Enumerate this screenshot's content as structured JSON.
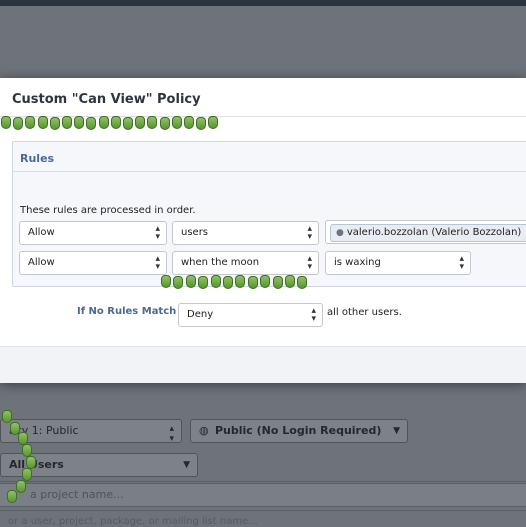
{
  "background": {
    "policy_select": "acy 1: Public",
    "visibility_select": "Public (No Login Required)",
    "users_select": "All Users",
    "project_search_placeholder": "a project name...",
    "bottom_hint": "or a user, project, package, or mailing list name..."
  },
  "dialog": {
    "title": "Custom \"Can View\" Policy",
    "rules": {
      "header": "Rules",
      "description": "These rules are processed in order.",
      "rows": [
        {
          "action": "Allow",
          "type": "users",
          "value_token": "valerio.bozzolan (Valerio Bozzolan)",
          "remove_symbol": "×"
        },
        {
          "action": "Allow",
          "type": "when the moon",
          "value": "is waxing"
        }
      ]
    },
    "fallback": {
      "label": "If No Rules Match",
      "value": "Deny",
      "suffix": "all other users."
    }
  },
  "icons": {
    "caret": "updown-caret-icon",
    "person": "user-icon",
    "globe": "globe-icon"
  },
  "colors": {
    "accent_label": "#4a6995",
    "title": "#2e3540",
    "backdrop": "#6e737a",
    "garland": "#6ea843"
  }
}
